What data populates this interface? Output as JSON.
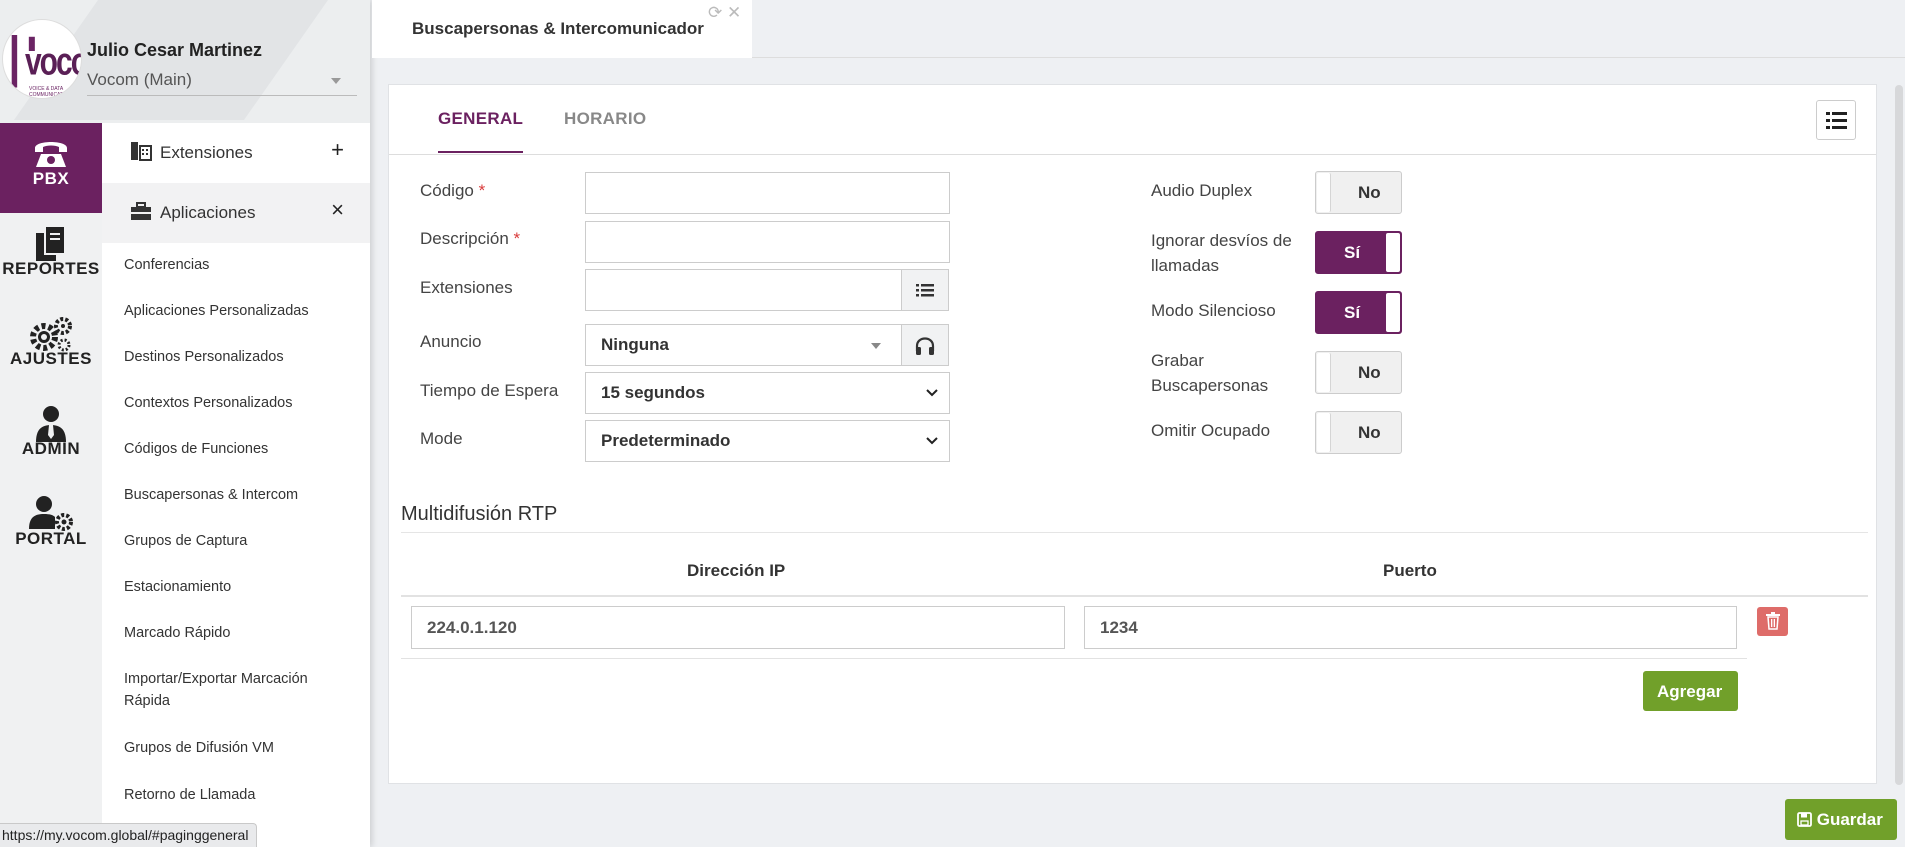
{
  "user": {
    "name": "Julio Cesar Martinez",
    "tenant": "Vocom (Main)"
  },
  "logo": {
    "text": "vocom",
    "tagline": "VOICE & DATA COMMUNICATIONS"
  },
  "rail": [
    {
      "label": "PBX",
      "icon": "phone-icon",
      "active": true
    },
    {
      "label": "REPORTES",
      "icon": "documents-icon"
    },
    {
      "label": "AJUSTES",
      "icon": "gears-icon"
    },
    {
      "label": "ADMIN",
      "icon": "admin-user-icon"
    },
    {
      "label": "PORTAL",
      "icon": "user-gear-icon"
    }
  ],
  "menu": {
    "extensiones": {
      "label": "Extensiones",
      "action": "+"
    },
    "aplicaciones": {
      "label": "Aplicaciones",
      "action": "×"
    },
    "items": [
      "Conferencias",
      "Aplicaciones Personalizadas",
      "Destinos Personalizados",
      "Contextos Personalizados",
      "Códigos de Funciones",
      "Buscapersonas & Intercom",
      "Grupos de Captura",
      "Estacionamiento",
      "Marcado Rápido",
      "Importar/Exportar Marcación Rápida",
      "Grupos de Difusión VM",
      "Retorno de Llamada"
    ]
  },
  "status_url": "https://my.vocom.global/#paginggeneral",
  "doc_tab": {
    "title": "Buscapersonas & Intercomunicador",
    "refresh_icon": "refresh-icon",
    "close_icon": "close-icon"
  },
  "tabs": {
    "general": "GENERAL",
    "horario": "HORARIO"
  },
  "form": {
    "codigo": {
      "label": "Código",
      "required": "*",
      "value": ""
    },
    "descripcion": {
      "label": "Descripción",
      "required": "*",
      "value": ""
    },
    "extensiones": {
      "label": "Extensiones",
      "value": ""
    },
    "anuncio": {
      "label": "Anuncio",
      "value": "Ninguna"
    },
    "tiempo": {
      "label": "Tiempo de Espera",
      "value": "15 segundos"
    },
    "mode": {
      "label": "Mode",
      "value": "Predeterminado"
    }
  },
  "toggles": {
    "audio_duplex": {
      "label": "Audio Duplex",
      "state": "No"
    },
    "ignorar": {
      "label": "Ignorar desvíos de llamadas",
      "state": "Sí"
    },
    "silencioso": {
      "label": "Modo Silencioso",
      "state": "Sí"
    },
    "grabar": {
      "label": "Grabar Buscapersonas",
      "state": "No"
    },
    "omitir": {
      "label": "Omitir Ocupado",
      "state": "No"
    }
  },
  "rtp": {
    "title": "Multidifusión RTP",
    "col_ip": "Dirección IP",
    "col_port": "Puerto",
    "rows": [
      {
        "ip": "224.0.1.120",
        "port": "1234"
      }
    ],
    "add_label": "Agregar"
  },
  "save_label": "Guardar",
  "colors": {
    "brand": "#6b2160",
    "success": "#71a02a",
    "danger": "#d9534f"
  }
}
